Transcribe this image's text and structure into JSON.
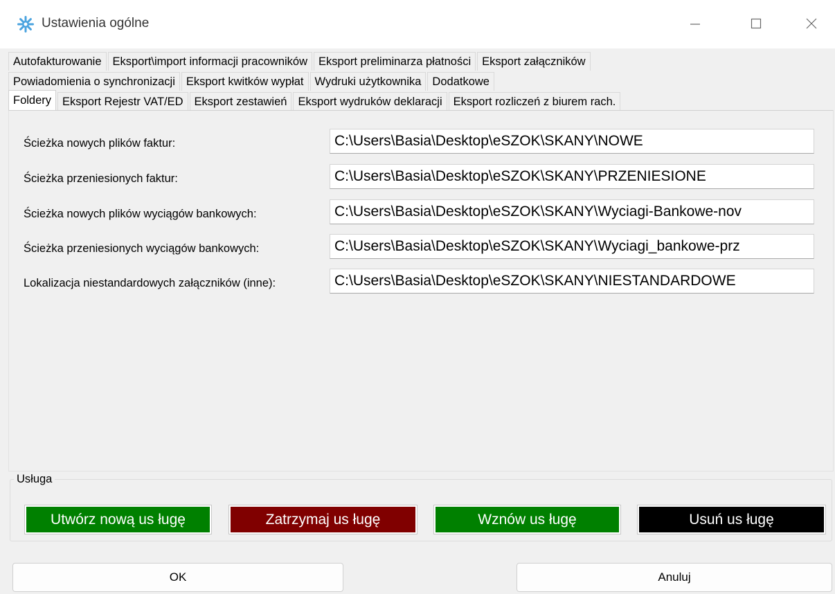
{
  "window": {
    "title": "Ustawienia ogólne",
    "icon": "gear-asterisk-icon",
    "controls": {
      "minimize": "—",
      "maximize": "☐",
      "close": "✕"
    }
  },
  "tabs": {
    "row1": [
      "Autofakturowanie",
      "Eksport\\import informacji  pracowników",
      "Eksport preliminarza płatności",
      "Eksport załączników"
    ],
    "row2": [
      "Powiadomienia o synchronizacji",
      "Eksport kwitków wypłat",
      "Wydruki użytkownika",
      "Dodatkowe"
    ],
    "row3": [
      "Foldery",
      "Eksport Rejestr VAT/ED",
      "Eksport zestawień",
      "Eksport wydruków deklaracji",
      "Eksport rozliczeń z biurem rach."
    ],
    "active": "Foldery"
  },
  "folders": [
    {
      "label": "Ścieżka nowych plików faktur:",
      "value": "C:\\Users\\Basia\\Desktop\\eSZOK\\SKANY\\NOWE"
    },
    {
      "label": "Ścieżka przeniesionych faktur:",
      "value": "C:\\Users\\Basia\\Desktop\\eSZOK\\SKANY\\PRZENIESIONE"
    },
    {
      "label": "Ścieżka nowych plików wyciągów bankowych:",
      "value": "C:\\Users\\Basia\\Desktop\\eSZOK\\SKANY\\Wyciagi-Bankowe-nov"
    },
    {
      "label": "Ścieżka przeniesionych wyciągów bankowych:",
      "value": "C:\\Users\\Basia\\Desktop\\eSZOK\\SKANY\\Wyciagi_bankowe-prz"
    },
    {
      "label": "Lokalizacja niestandardowych załączników (inne):",
      "value": "C:\\Users\\Basia\\Desktop\\eSZOK\\SKANY\\NIESTANDARDOWE"
    }
  ],
  "service": {
    "group_title": "Usługa",
    "create": "Utwórz nową us ługę",
    "stop": "Zatrzymaj us ługę",
    "resume": "Wznów us ługę",
    "delete": "Usuń us ługę",
    "colors": {
      "create": "#008000",
      "stop": "#800000",
      "resume": "#008000",
      "delete": "#000000"
    }
  },
  "dialog": {
    "ok": "OK",
    "cancel": "Anuluj"
  }
}
